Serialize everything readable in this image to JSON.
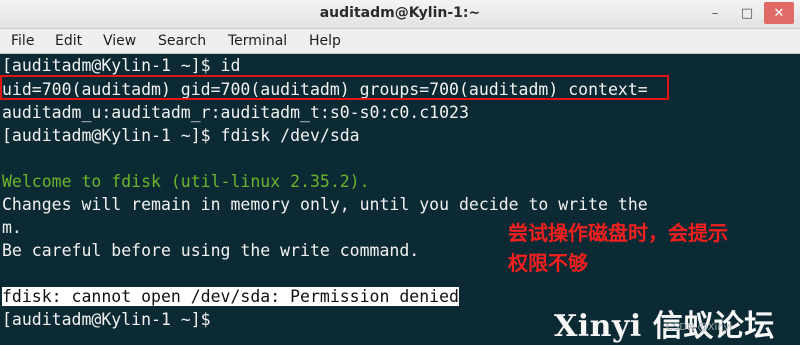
{
  "window": {
    "title": "auditadm@Kylin-1:~",
    "minimize_icon": "minimize-icon",
    "maximize_icon": "maximize-icon",
    "close_icon": "close-icon"
  },
  "menu": [
    "File",
    "Edit",
    "View",
    "Search",
    "Terminal",
    "Help"
  ],
  "terminal": {
    "lines": [
      "[auditadm@Kylin-1 ~]$ id",
      "uid=700(auditadm) gid=700(auditadm) groups=700(auditadm) context=",
      "auditadm_u:auditadm_r:auditadm_t:s0-s0:c0.c1023",
      "[auditadm@Kylin-1 ~]$ fdisk /dev/sda",
      "",
      "Welcome to fdisk (util-linux 2.35.2).",
      "Changes will remain in memory only, until you decide to write the",
      "m.",
      "Be careful before using the write command.",
      "",
      "fdisk: cannot open /dev/sda: Permission denied",
      "[auditadm@Kylin-1 ~]$"
    ]
  },
  "annotation": {
    "line1": "尝试操作磁盘时，会提示",
    "line2": "权限不够"
  },
  "watermark": {
    "logo": "Xinyi 信蚁论坛",
    "small": "CSDN @Xinyi"
  }
}
